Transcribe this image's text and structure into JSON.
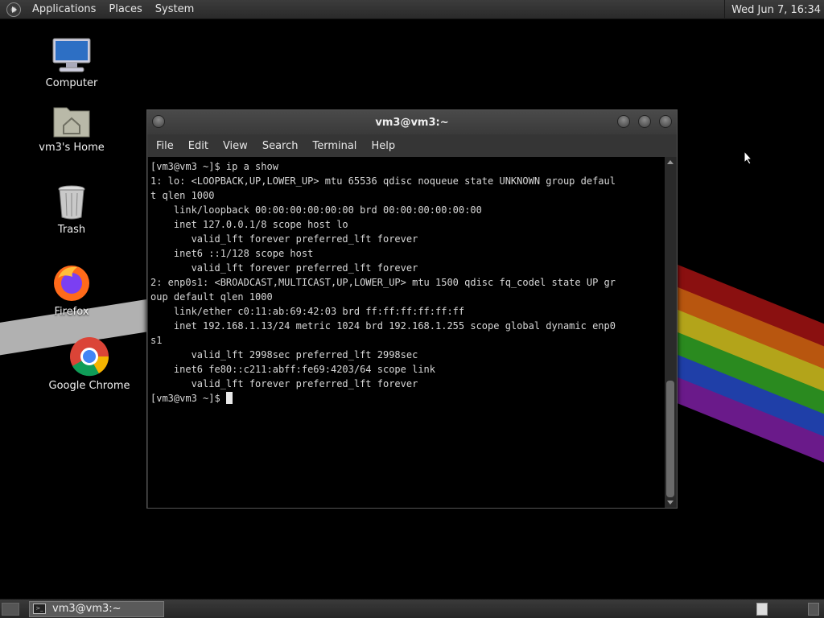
{
  "top_panel": {
    "menus": [
      "Applications",
      "Places",
      "System"
    ],
    "clock": "Wed Jun  7, 16:34"
  },
  "desktop": {
    "icons": [
      {
        "label": "Computer",
        "icon": "computer-icon"
      },
      {
        "label": "vm3's Home",
        "icon": "home-folder-icon"
      },
      {
        "label": "Trash",
        "icon": "trash-icon"
      },
      {
        "label": "Firefox",
        "icon": "firefox-icon"
      },
      {
        "label": "Google Chrome",
        "icon": "chrome-icon"
      }
    ]
  },
  "window": {
    "title": "vm3@vm3:~",
    "menus": [
      "File",
      "Edit",
      "View",
      "Search",
      "Terminal",
      "Help"
    ],
    "terminal_lines": [
      "[vm3@vm3 ~]$ ip a show",
      "1: lo: <LOOPBACK,UP,LOWER_UP> mtu 65536 qdisc noqueue state UNKNOWN group defaul",
      "t qlen 1000",
      "    link/loopback 00:00:00:00:00:00 brd 00:00:00:00:00:00",
      "    inet 127.0.0.1/8 scope host lo",
      "       valid_lft forever preferred_lft forever",
      "    inet6 ::1/128 scope host",
      "       valid_lft forever preferred_lft forever",
      "2: enp0s1: <BROADCAST,MULTICAST,UP,LOWER_UP> mtu 1500 qdisc fq_codel state UP gr",
      "oup default qlen 1000",
      "    link/ether c0:11:ab:69:42:03 brd ff:ff:ff:ff:ff:ff",
      "    inet 192.168.1.13/24 metric 1024 brd 192.168.1.255 scope global dynamic enp0",
      "s1",
      "       valid_lft 2998sec preferred_lft 2998sec",
      "    inet6 fe80::c211:abff:fe69:4203/64 scope link",
      "       valid_lft forever preferred_lft forever"
    ],
    "prompt": "[vm3@vm3 ~]$ "
  },
  "bottom_panel": {
    "task_label": "vm3@vm3:~"
  },
  "colors": {
    "panel": "#333333",
    "terminal_bg": "#000000",
    "terminal_fg": "#d8d8d8"
  }
}
